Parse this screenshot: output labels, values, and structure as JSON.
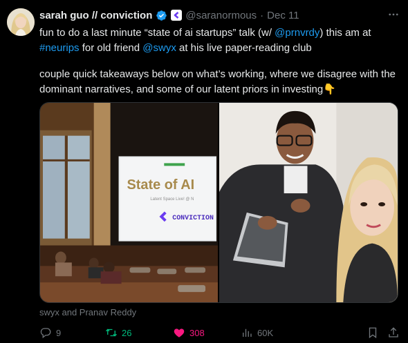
{
  "author": {
    "name": "sarah guo // conviction",
    "handle": "@saranormous",
    "separator": "·",
    "date": "Dec 11"
  },
  "icons": {
    "avatar": "profile-photo",
    "verified": "verified-badge-icon",
    "affiliate": "conviction-logo-icon",
    "more": "more-icon"
  },
  "tweet": {
    "line1_pre": "fun to do a last minute “state of ai startups” talk (w/ ",
    "mention1": "@prnvrdy",
    "line1_post": ") this am at",
    "hashtag": "#neurips",
    "line2_mid": " for old friend ",
    "mention2": "@swyx",
    "line2_post": " at his live paper-reading club",
    "paragraph2": "couple quick takeaways below on what’s working, where we disagree with the dominant narratives, and some of our latent priors in investing",
    "emoji": "👇"
  },
  "media": {
    "slide_title": "State of AI",
    "slide_sub": "Latent Space Live! @ N",
    "slide_logo_text": "CONVICTION",
    "caption": "swyx and Pranav Reddy"
  },
  "actions": {
    "replies": "9",
    "retweets": "26",
    "likes": "308",
    "views": "60K"
  },
  "colors": {
    "background": "#000000",
    "text": "#e7e9ea",
    "muted": "#71767b",
    "link": "#1d9bf0",
    "retweet": "#00ba7c",
    "like": "#f91880",
    "verified": "#1d9bf0",
    "affiliate": "#6a3cf0"
  }
}
